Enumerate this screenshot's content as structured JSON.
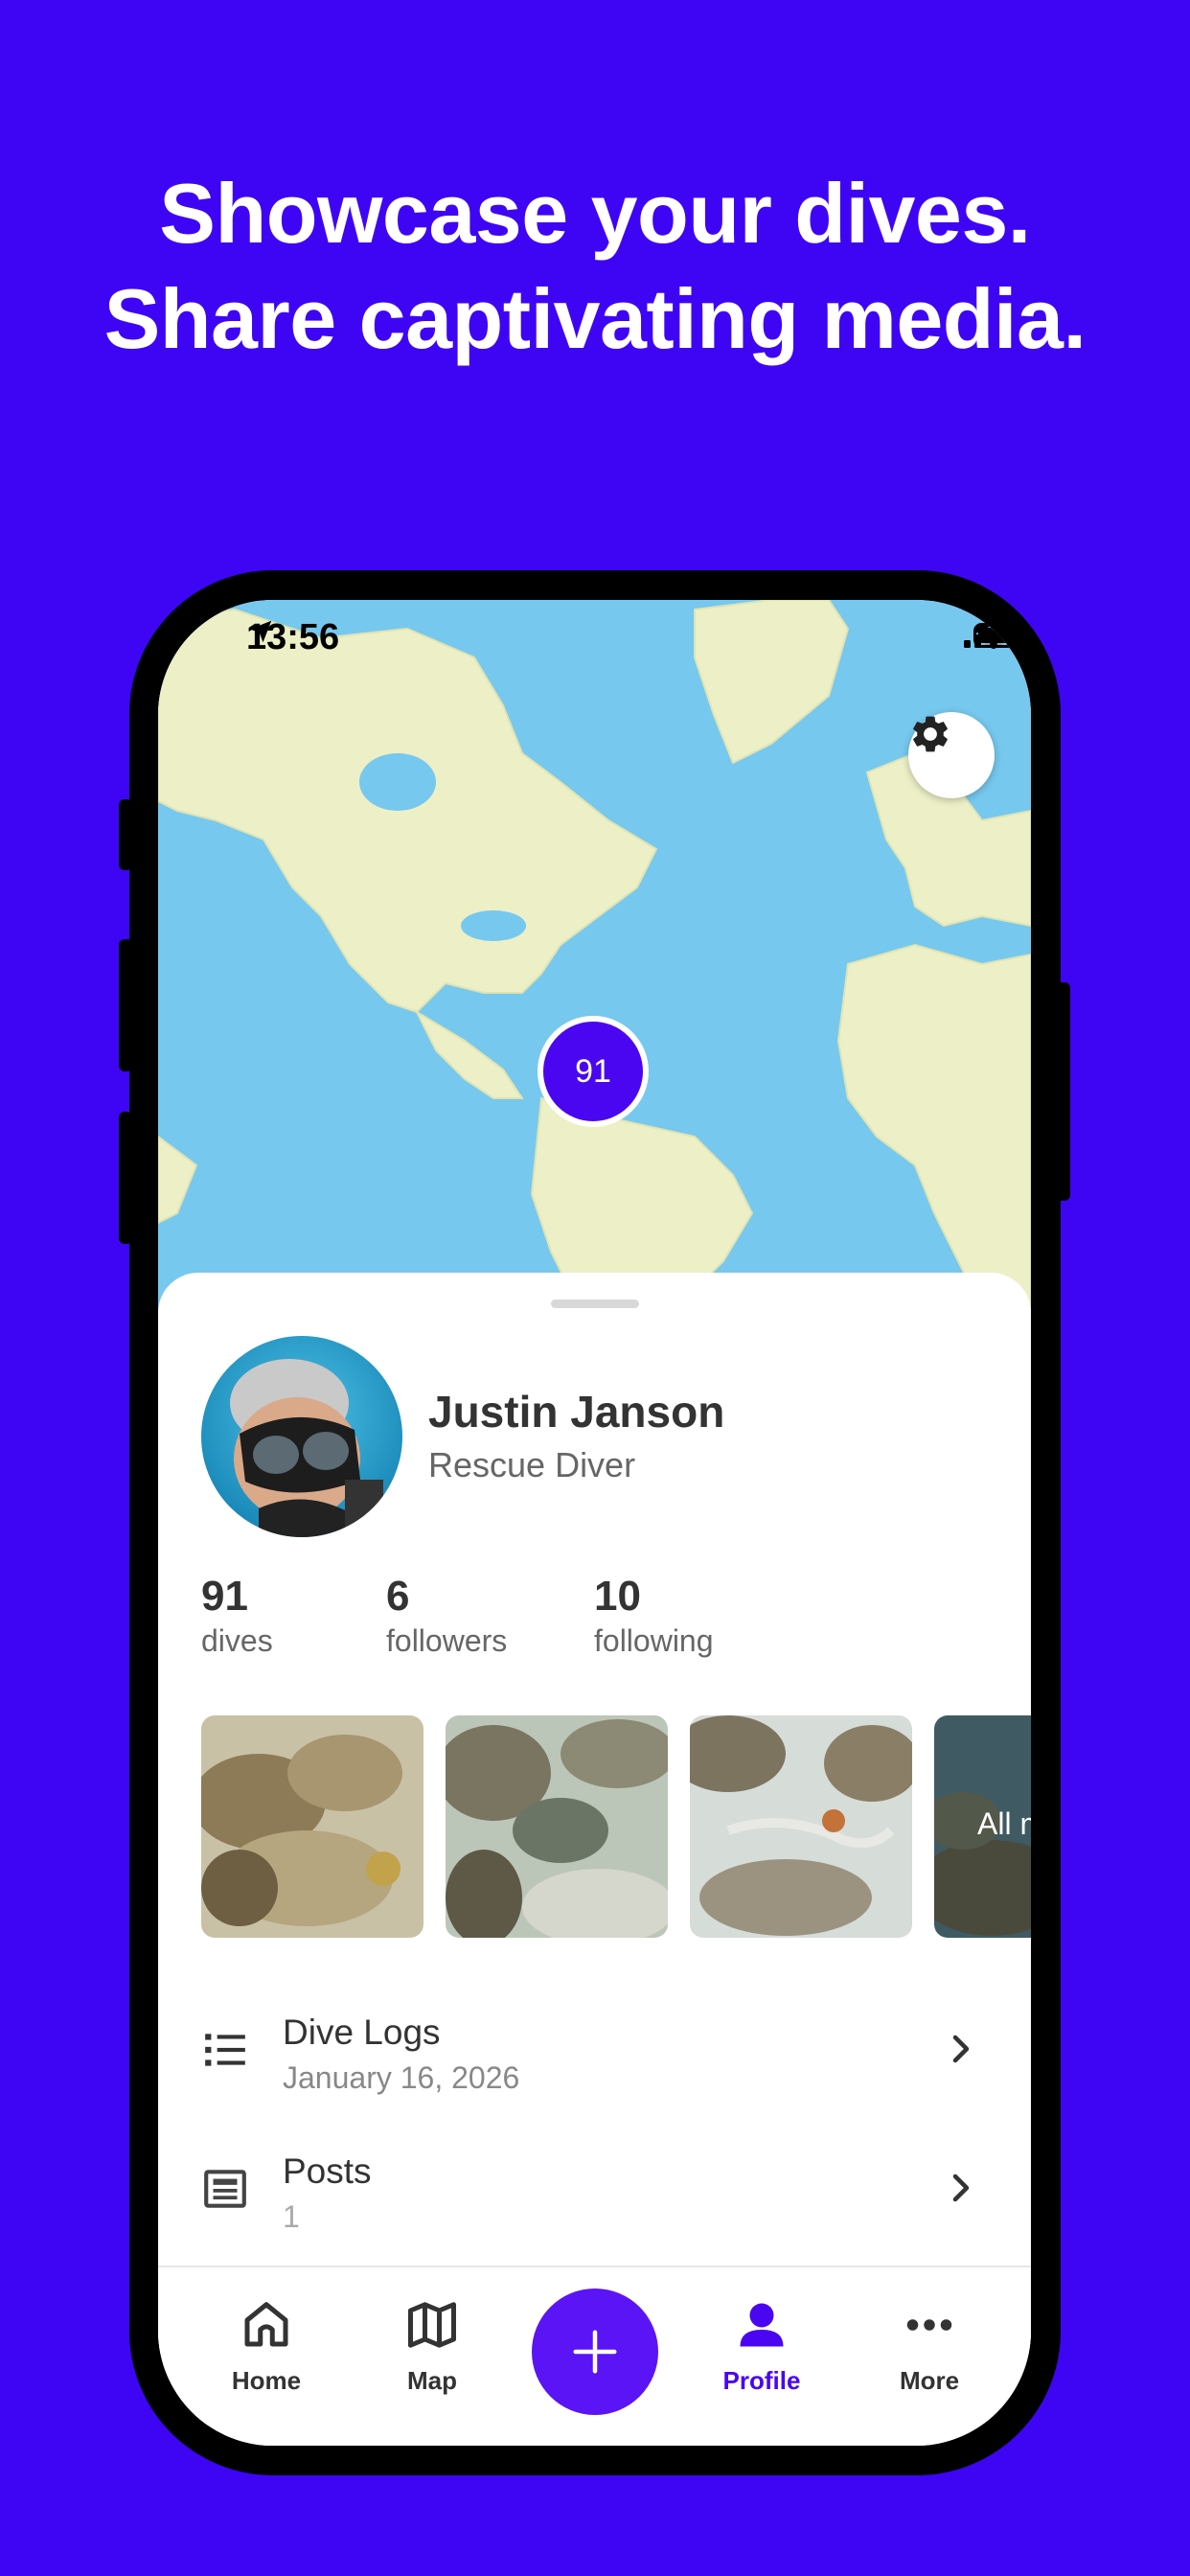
{
  "headline": {
    "line1": "Showcase your dives.",
    "line2": "Share captivating media."
  },
  "status_bar": {
    "time": "13:56"
  },
  "map": {
    "cluster_count": "91"
  },
  "profile": {
    "name": "Justin Janson",
    "certification": "Rescue Diver",
    "stats": [
      {
        "value": "91",
        "label": "dives"
      },
      {
        "value": "6",
        "label": "followers"
      },
      {
        "value": "10",
        "label": "following"
      }
    ],
    "media_more_label": "All media"
  },
  "list": [
    {
      "title": "Dive Logs",
      "subtitle": "January 16, 2026"
    },
    {
      "title": "Posts",
      "subtitle": "1"
    }
  ],
  "tabs": [
    {
      "label": "Home",
      "icon": "home-icon"
    },
    {
      "label": "Map",
      "icon": "map-icon"
    },
    {
      "label": "Profile",
      "icon": "profile-icon",
      "active": true
    },
    {
      "label": "More",
      "icon": "more-icon"
    }
  ],
  "colors": {
    "brand": "#3e05f5",
    "accent": "#4a06f0"
  }
}
